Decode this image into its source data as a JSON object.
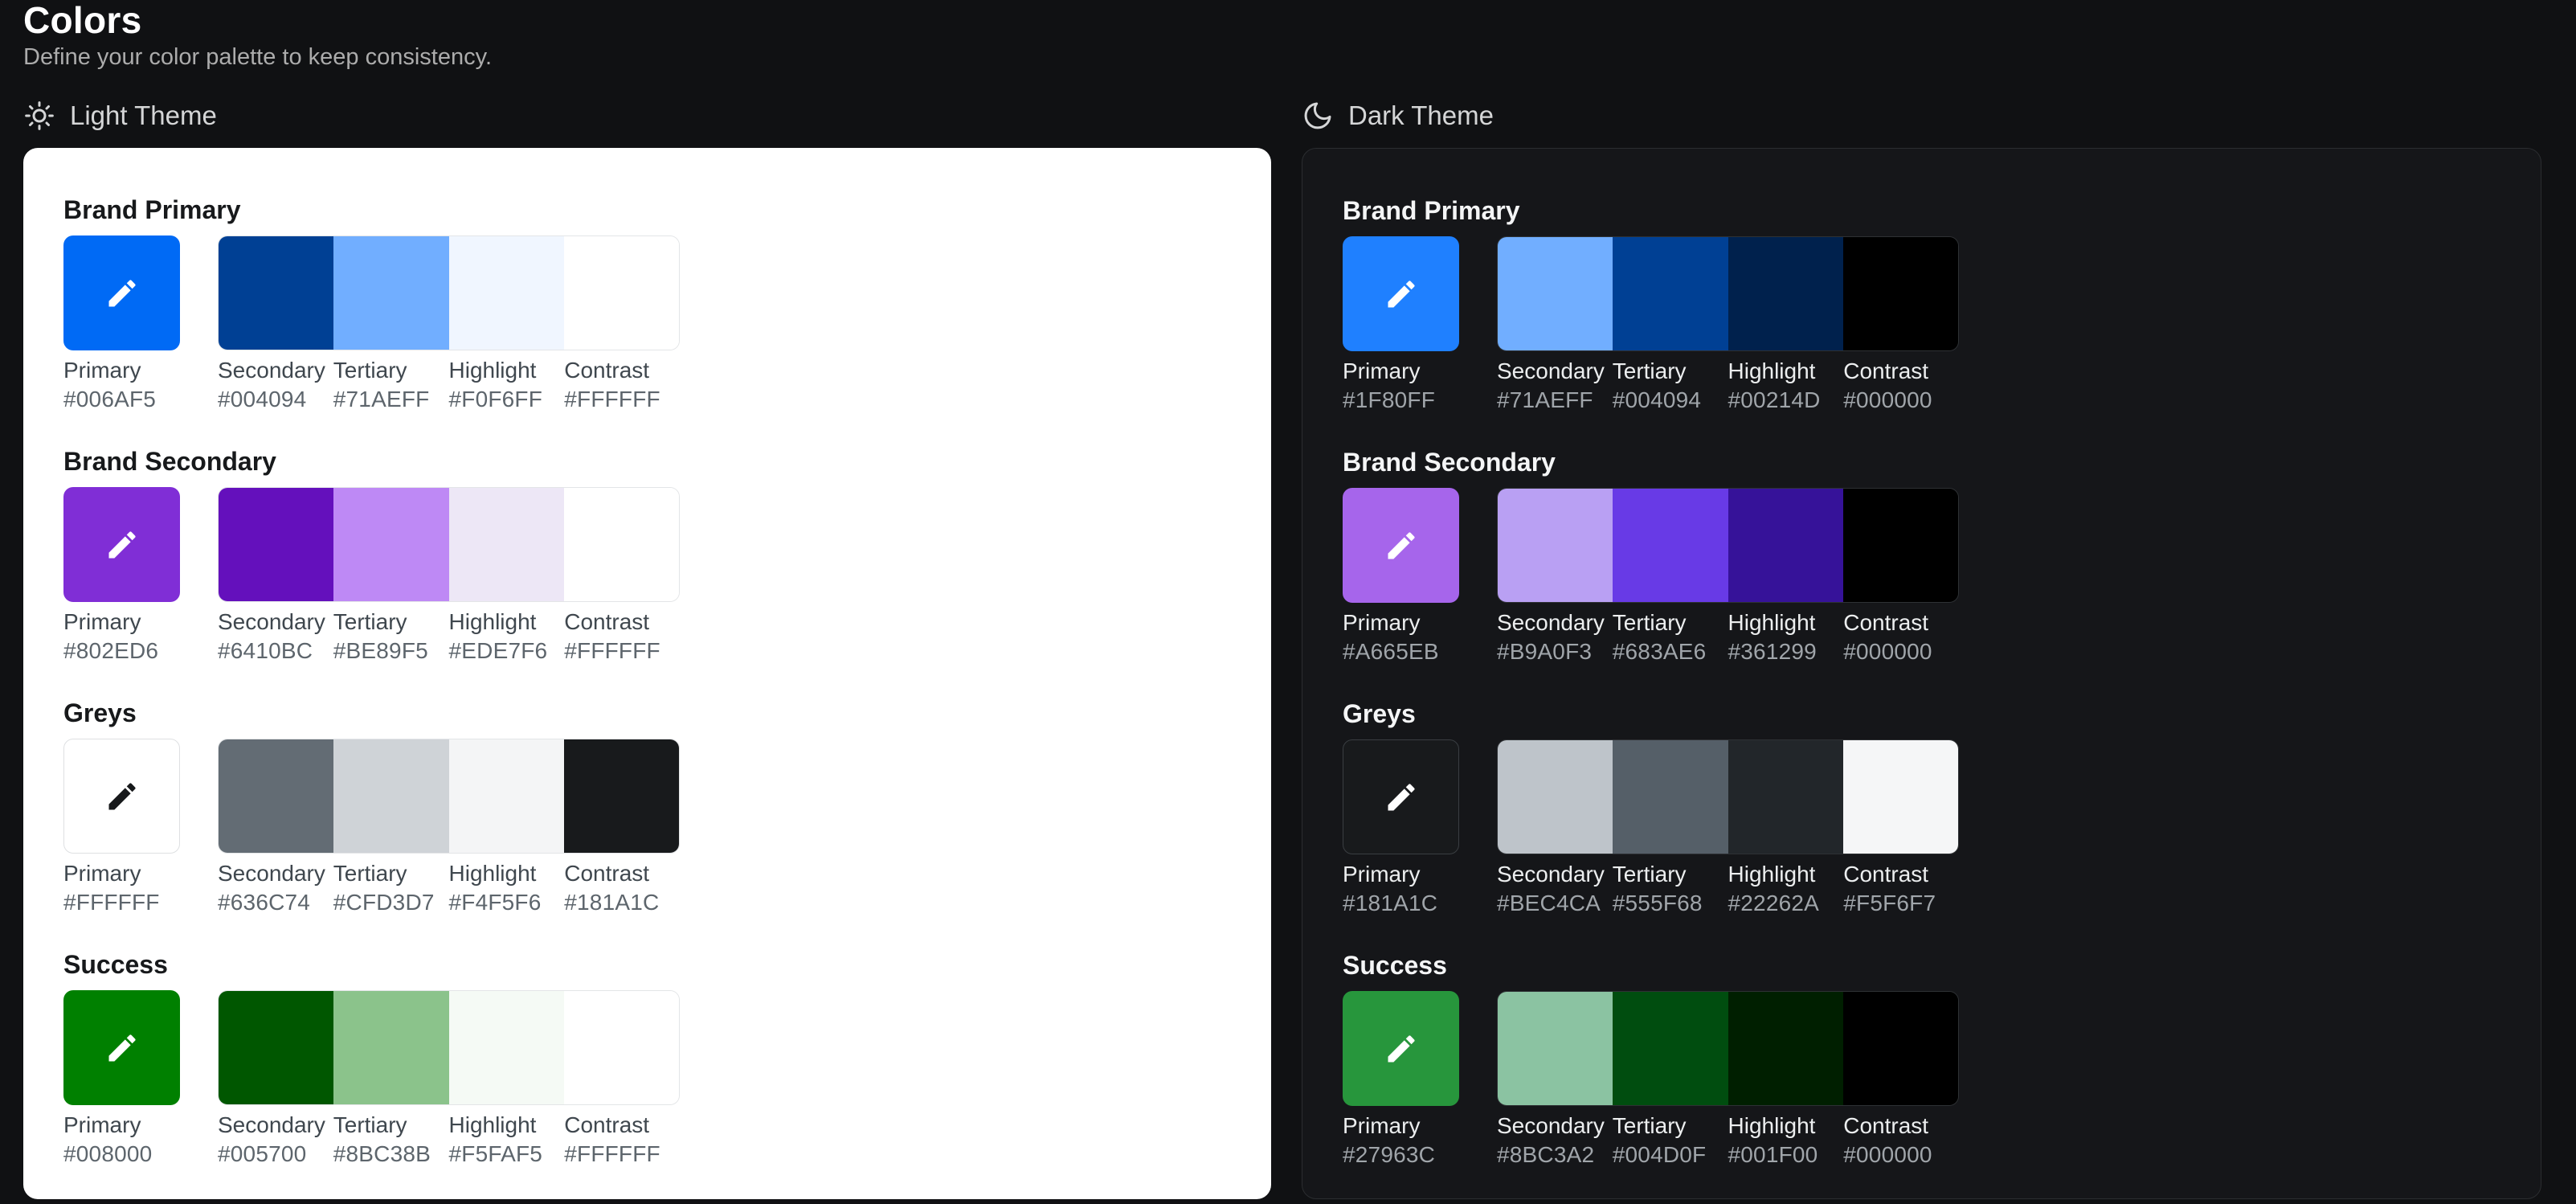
{
  "page": {
    "title": "Colors",
    "subtitle": "Define your color palette to keep consistency."
  },
  "ui_colors": {
    "page_background": "#101113",
    "light_panel_background": "#FFFFFF",
    "dark_panel_background": "#151619",
    "dark_panel_border": "#2B2D30"
  },
  "swatch_role_labels": [
    "Primary",
    "Secondary",
    "Tertiary",
    "Highlight",
    "Contrast"
  ],
  "themes": [
    {
      "id": "light",
      "label": "Light Theme",
      "icon": "sun-icon",
      "sections": [
        {
          "name": "Brand Primary",
          "swatches": [
            {
              "label": "Primary",
              "hex": "#006AF5"
            },
            {
              "label": "Secondary",
              "hex": "#004094"
            },
            {
              "label": "Tertiary",
              "hex": "#71AEFF"
            },
            {
              "label": "Highlight",
              "hex": "#F0F6FF"
            },
            {
              "label": "Contrast",
              "hex": "#FFFFFF"
            }
          ]
        },
        {
          "name": "Brand Secondary",
          "swatches": [
            {
              "label": "Primary",
              "hex": "#802ED6"
            },
            {
              "label": "Secondary",
              "hex": "#6410BC"
            },
            {
              "label": "Tertiary",
              "hex": "#BE89F5"
            },
            {
              "label": "Highlight",
              "hex": "#EDE7F6"
            },
            {
              "label": "Contrast",
              "hex": "#FFFFFF"
            }
          ]
        },
        {
          "name": "Greys",
          "swatches": [
            {
              "label": "Primary",
              "hex": "#FFFFFF"
            },
            {
              "label": "Secondary",
              "hex": "#636C74"
            },
            {
              "label": "Tertiary",
              "hex": "#CFD3D7"
            },
            {
              "label": "Highlight",
              "hex": "#F4F5F6"
            },
            {
              "label": "Contrast",
              "hex": "#181A1C"
            }
          ]
        },
        {
          "name": "Success",
          "swatches": [
            {
              "label": "Primary",
              "hex": "#008000"
            },
            {
              "label": "Secondary",
              "hex": "#005700"
            },
            {
              "label": "Tertiary",
              "hex": "#8BC38B"
            },
            {
              "label": "Highlight",
              "hex": "#F5FAF5"
            },
            {
              "label": "Contrast",
              "hex": "#FFFFFF"
            }
          ]
        }
      ]
    },
    {
      "id": "dark",
      "label": "Dark Theme",
      "icon": "moon-icon",
      "sections": [
        {
          "name": "Brand Primary",
          "swatches": [
            {
              "label": "Primary",
              "hex": "#1F80FF"
            },
            {
              "label": "Secondary",
              "hex": "#71AEFF"
            },
            {
              "label": "Tertiary",
              "hex": "#004094"
            },
            {
              "label": "Highlight",
              "hex": "#00214D"
            },
            {
              "label": "Contrast",
              "hex": "#000000"
            }
          ]
        },
        {
          "name": "Brand Secondary",
          "swatches": [
            {
              "label": "Primary",
              "hex": "#A665EB"
            },
            {
              "label": "Secondary",
              "hex": "#B9A0F3"
            },
            {
              "label": "Tertiary",
              "hex": "#683AE6"
            },
            {
              "label": "Highlight",
              "hex": "#361299"
            },
            {
              "label": "Contrast",
              "hex": "#000000"
            }
          ]
        },
        {
          "name": "Greys",
          "swatches": [
            {
              "label": "Primary",
              "hex": "#181A1C"
            },
            {
              "label": "Secondary",
              "hex": "#BEC4CA"
            },
            {
              "label": "Tertiary",
              "hex": "#555F68"
            },
            {
              "label": "Highlight",
              "hex": "#22262A"
            },
            {
              "label": "Contrast",
              "hex": "#F5F6F7"
            }
          ]
        },
        {
          "name": "Success",
          "swatches": [
            {
              "label": "Primary",
              "hex": "#27963C"
            },
            {
              "label": "Secondary",
              "hex": "#8BC3A2"
            },
            {
              "label": "Tertiary",
              "hex": "#004D0F"
            },
            {
              "label": "Highlight",
              "hex": "#001F00"
            },
            {
              "label": "Contrast",
              "hex": "#000000"
            }
          ]
        }
      ]
    }
  ]
}
